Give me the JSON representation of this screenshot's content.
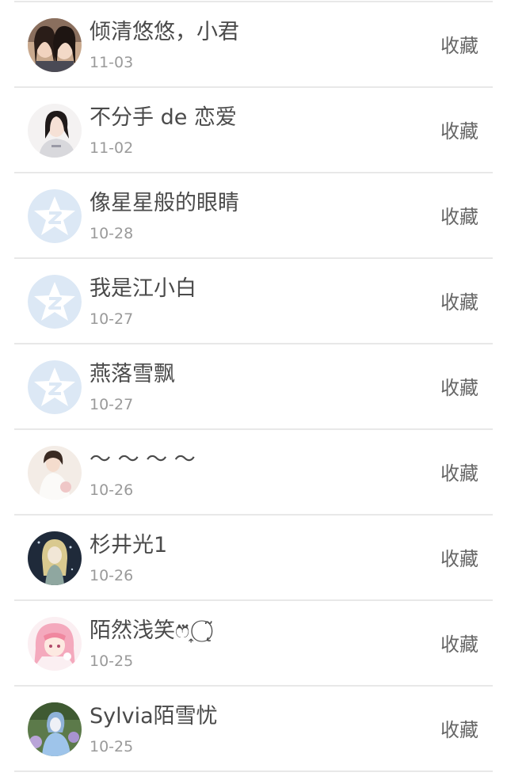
{
  "colors": {
    "name_text": "#4a4a4a",
    "date_text": "#9a9a9a",
    "favorite_text": "#666666",
    "divider": "#e8e8e8",
    "default_avatar_bg": "#dce8f5"
  },
  "friends": [
    {
      "name": "倾清悠悠，小君",
      "date": "11-03",
      "action": "收藏",
      "avatar": "photo-two-girls-avatar-icon"
    },
    {
      "name": "不分手 de 恋爱",
      "date": "11-02",
      "action": "收藏",
      "avatar": "photo-girl-avatar-icon"
    },
    {
      "name": "像星星般的眼睛",
      "date": "10-28",
      "action": "收藏",
      "avatar": "default-qzone-star-avatar-icon"
    },
    {
      "name": "我是江小白",
      "date": "10-27",
      "action": "收藏",
      "avatar": "default-qzone-star-avatar-icon"
    },
    {
      "name": "燕落雪飘",
      "date": "10-27",
      "action": "收藏",
      "avatar": "default-qzone-star-avatar-icon"
    },
    {
      "name": "～ ～ ～ ～",
      "date": "10-26",
      "action": "收藏",
      "avatar": "photo-girl-white-dress-avatar-icon"
    },
    {
      "name": "杉井光1",
      "date": "10-26",
      "action": "收藏",
      "avatar": "anime-girl-dark-avatar-icon"
    },
    {
      "name": "陌然浅笑ෆ⃛ ͎ ⃝ ̨͂",
      "date": "10-25",
      "action": "收藏",
      "avatar": "anime-pink-hair-avatar-icon"
    },
    {
      "name": "Sylvia陌雪忧",
      "date": "10-25",
      "action": "收藏",
      "avatar": "anime-blue-dress-avatar-icon"
    }
  ]
}
